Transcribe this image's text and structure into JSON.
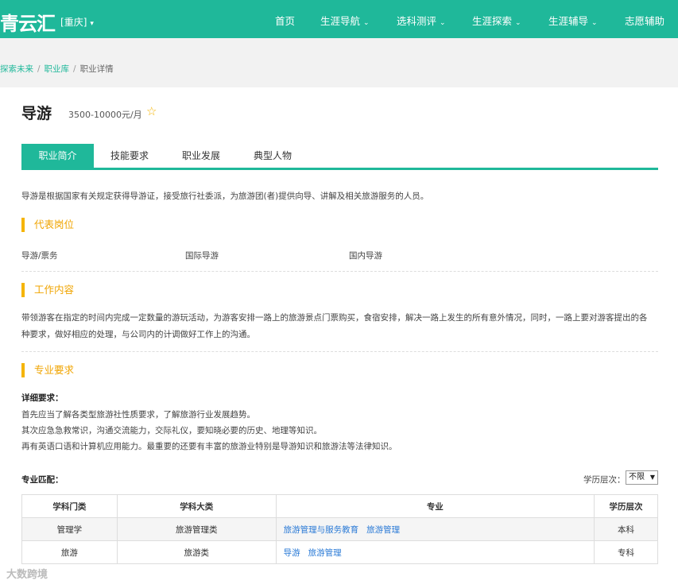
{
  "header": {
    "logo": "青云汇",
    "city": "重庆",
    "nav": [
      "首页",
      "生涯导航",
      "选科测评",
      "生涯探索",
      "生涯辅导",
      "志愿辅助"
    ]
  },
  "breadcrumb": [
    "探索未来",
    "职业库",
    "职业详情"
  ],
  "career": {
    "title": "导游",
    "salary": "3500-10000元/月"
  },
  "tabs": [
    "职业简介",
    "技能要求",
    "职业发展",
    "典型人物"
  ],
  "intro": "导游是根据国家有关规定获得导游证，接受旅行社委派，为旅游团(者)提供向导、讲解及相关旅游服务的人员。",
  "sections": {
    "positions_title": "代表岗位",
    "positions": [
      "导游/票务",
      "国际导游",
      "国内导游"
    ],
    "work_title": "工作内容",
    "work_line1": "带领游客在指定的时间内完成一定数量的游玩活动，为游客安排一路上的旅游景点门票购买，食宿安排，解决一路上发生的所有意外情况，同时，一路上要对游客提出的各",
    "work_line2": "种要求，做好相应的处理，与公司内的计调做好工作上的沟通。",
    "req_title": "专业要求",
    "req_label": "详细要求：",
    "req_line1": "首先应当了解各类型旅游社性质要求，了解旅游行业发展趋势。",
    "req_line2": "其次应急急救常识，沟通交流能力，交际礼仪，要知晓必要的历史、地理等知识。",
    "req_line3": "再有英语口语和计算机应用能力。最重要的还要有丰富的旅游业特别是导游知识和旅游法等法律知识。"
  },
  "match": {
    "label": "专业匹配：",
    "edu_label": "学历层次：",
    "edu_value": "不限",
    "headers": [
      "学科门类",
      "学科大类",
      "专业",
      "学历层次"
    ],
    "rows": [
      {
        "category": "管理学",
        "group": "旅游管理类",
        "majors": [
          "旅游管理与服务教育",
          "旅游管理"
        ],
        "level": "本科"
      },
      {
        "category": "旅游",
        "group": "旅游类",
        "majors": [
          "导游",
          "旅游管理"
        ],
        "level": "专科"
      }
    ]
  },
  "watermark": "大数跨境"
}
